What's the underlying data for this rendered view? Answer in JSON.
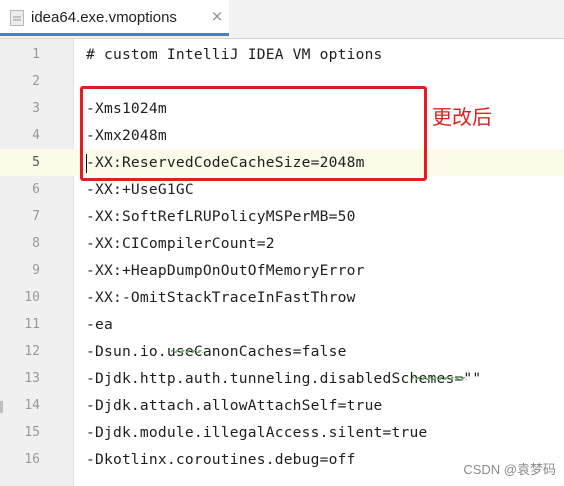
{
  "tab": {
    "title": "idea64.exe.vmoptions",
    "close_glyph": "×",
    "icon": "file-icon"
  },
  "editor": {
    "lines": [
      {
        "number": "1",
        "text": "# custom IntelliJ IDEA VM options"
      },
      {
        "number": "2",
        "text": ""
      },
      {
        "number": "3",
        "text": "-Xms1024m"
      },
      {
        "number": "4",
        "text": "-Xmx2048m"
      },
      {
        "number": "5",
        "text": "-XX:ReservedCodeCacheSize=2048m"
      },
      {
        "number": "6",
        "text": "-XX:+UseG1GC"
      },
      {
        "number": "7",
        "text": "-XX:SoftRefLRUPolicyMSPerMB=50"
      },
      {
        "number": "8",
        "text": "-XX:CICompilerCount=2"
      },
      {
        "number": "9",
        "text": "-XX:+HeapDumpOnOutOfMemoryError"
      },
      {
        "number": "10",
        "text": "-XX:-OmitStackTraceInFastThrow"
      },
      {
        "number": "11",
        "text": "-ea"
      },
      {
        "number": "12",
        "text": "-Dsun.io.useCanonCaches=false"
      },
      {
        "number": "13",
        "text": "-Djdk.http.auth.tunneling.disabledSchemes=\"\""
      },
      {
        "number": "14",
        "text": "-Djdk.attach.allowAttachSelf=true"
      },
      {
        "number": "15",
        "text": "-Djdk.module.illegalAccess.silent=true"
      },
      {
        "number": "16",
        "text": "-Dkotlinx.coroutines.debug=off"
      }
    ],
    "current_line": "5"
  },
  "annotation": {
    "text": "更改后",
    "color": "#e02020"
  },
  "watermark": {
    "text": "CSDN @袁梦码"
  },
  "colors": {
    "tab_accent": "#4083c9",
    "current_line_bg": "#fcfae8",
    "gutter_bg": "#f0f0f0"
  }
}
